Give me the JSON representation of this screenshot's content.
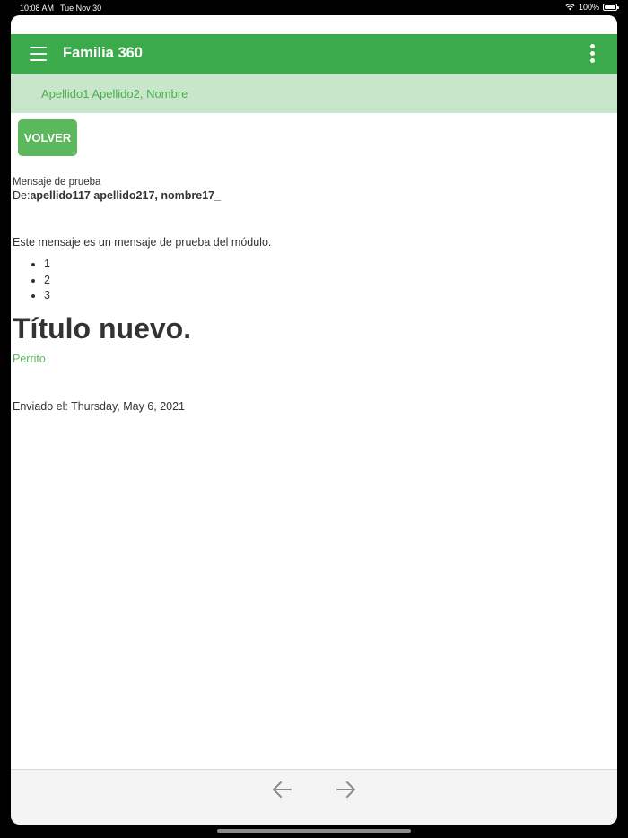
{
  "status_bar": {
    "time": "10:08 AM",
    "date": "Tue Nov 30",
    "battery_percent": "100%"
  },
  "app_bar": {
    "title": "Familia 360"
  },
  "sub_header": {
    "student_name": "Apellido1 Apellido2, Nombre"
  },
  "content": {
    "back_button_label": "VOLVER",
    "subject": "Mensaje de prueba",
    "from_label": "De:",
    "from_name": "apellido117 apellido217, nombre17_",
    "body_text": "Este mensaje es un mensaje de prueba del módulo.",
    "list_items": [
      "1",
      "2",
      "3"
    ],
    "heading": "Título nuevo.",
    "link_text": "Perrito",
    "sent_label": "Enviado el: Thursday, May 6, 2021"
  },
  "colors": {
    "primary": "#3aaa4a",
    "sub_header_bg": "#c8e6c9",
    "accent": "#5cb85c"
  },
  "icons": {
    "menu": "hamburger-menu-icon",
    "more": "vertical-dots-icon",
    "back": "arrow-left-icon",
    "forward": "arrow-right-icon"
  }
}
